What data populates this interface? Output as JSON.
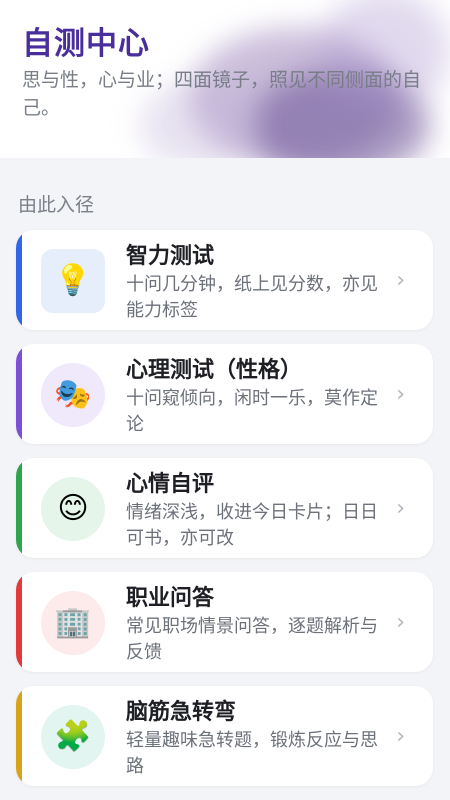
{
  "header": {
    "title": "自测中心",
    "subtitle": "思与性，心与业；四面镜子，照见不同侧面的自己。"
  },
  "section_label": "由此入径",
  "cards": [
    {
      "title": "智力测试",
      "desc": "十问几分钟，纸上见分数，亦见能力标签",
      "icon": "lightbulb-icon",
      "glyph": "💡",
      "accent": "#3366e6",
      "icon_bg": "#e6eefc"
    },
    {
      "title": "心理测试（性格）",
      "desc": "十问窥倾向，闲时一乐，莫作定论",
      "icon": "theater-masks-icon",
      "glyph": "🎭",
      "accent": "#7b4fd6",
      "icon_bg": "#efe9fb"
    },
    {
      "title": "心情自评",
      "desc": "情绪深浅，收进今日卡片；日日可书，亦可改",
      "icon": "smiley-face-icon",
      "glyph": "😊",
      "accent": "#2ea44f",
      "icon_bg": "#e5f5ea"
    },
    {
      "title": "职业问答",
      "desc": "常见职场情景问答，逐题解析与反馈",
      "icon": "office-building-icon",
      "glyph": "🏢",
      "accent": "#e03a3a",
      "icon_bg": "#fdeaea"
    },
    {
      "title": "脑筋急转弯",
      "desc": "轻量趣味急转题，锻炼反应与思路",
      "icon": "puzzle-piece-icon",
      "glyph": "🧩",
      "accent": "#d9a21b",
      "icon_bg": "#e2f5f1"
    }
  ],
  "chevron": "›"
}
